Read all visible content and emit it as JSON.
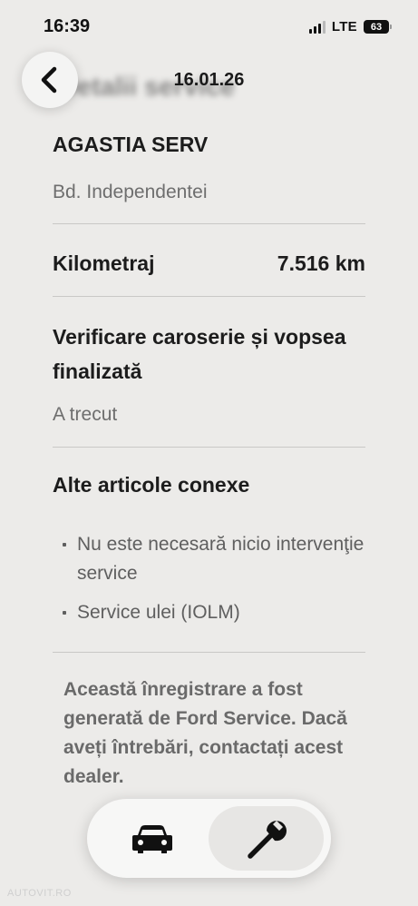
{
  "status_bar": {
    "time": "16:39",
    "network": "LTE",
    "battery": "63"
  },
  "header": {
    "blurred_title": "Detalii service",
    "date": "16.01.26"
  },
  "dealer": {
    "name": "AGASTIA SERV",
    "address": "Bd. Independentei"
  },
  "odometer": {
    "label": "Kilometraj",
    "value": "7.516 km"
  },
  "inspection": {
    "title": "Verificare caroserie și vopsea finalizată",
    "status": "A trecut"
  },
  "related": {
    "title": "Alte articole conexe",
    "items": [
      {
        "label": "Nu este necesară nicio intervenţie service"
      },
      {
        "label": "Service ulei (IOLM)"
      }
    ]
  },
  "footer_note": "Această înregistrare a fost generată de Ford Service. Dacă aveți întrebări, contactați acest dealer.",
  "bottom_nav": {
    "items": [
      {
        "icon": "car-icon"
      },
      {
        "icon": "wrench-icon",
        "selected": true
      }
    ]
  },
  "watermark": "AUTOVIT.RO"
}
